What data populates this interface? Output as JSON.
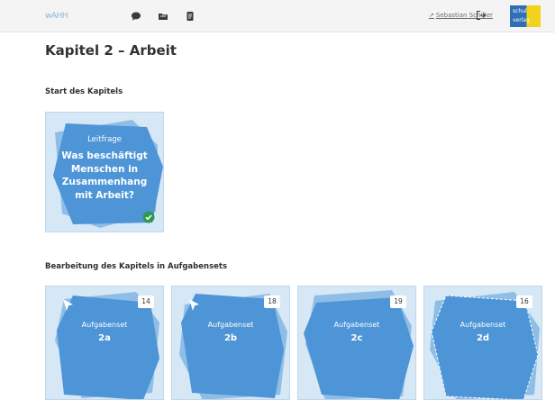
{
  "header": {
    "logo_text": "wAHH",
    "nav_icons": [
      "chat-bubble-icon",
      "folder-icon",
      "document-icon"
    ],
    "user_name": "Sebastian Schüler",
    "user_arrow": "↗",
    "logout_icon": "logout-icon",
    "brand_line1": "schul",
    "brand_line2": "verlag"
  },
  "page": {
    "title": "Kapitel 2 – Arbeit"
  },
  "start_section": {
    "heading": "Start des Kapitels",
    "card": {
      "label": "Leitfrage",
      "question": "Was beschäftigt Menschen in Zusammenhang mit Arbeit?",
      "status": "completed",
      "status_icon": "check-circle-icon"
    }
  },
  "sets_section": {
    "heading": "Bearbeitung des Kapitels in Aufgabensets",
    "cards": [
      {
        "label": "Aufgabenset",
        "id": "2a",
        "count": "14",
        "icon": "cursor-icon"
      },
      {
        "label": "Aufgabenset",
        "id": "2b",
        "count": "18",
        "icon": "cursor-icon"
      },
      {
        "label": "Aufgabenset",
        "id": "2c",
        "count": "19",
        "icon": ""
      },
      {
        "label": "Aufgabenset",
        "id": "2d",
        "count": "16",
        "icon": ""
      }
    ]
  },
  "colors": {
    "card_background": "#d6e7f6",
    "shape_primary": "#4d95d6",
    "shape_secondary": "#8ebde6",
    "check": "#2e9a4f"
  }
}
